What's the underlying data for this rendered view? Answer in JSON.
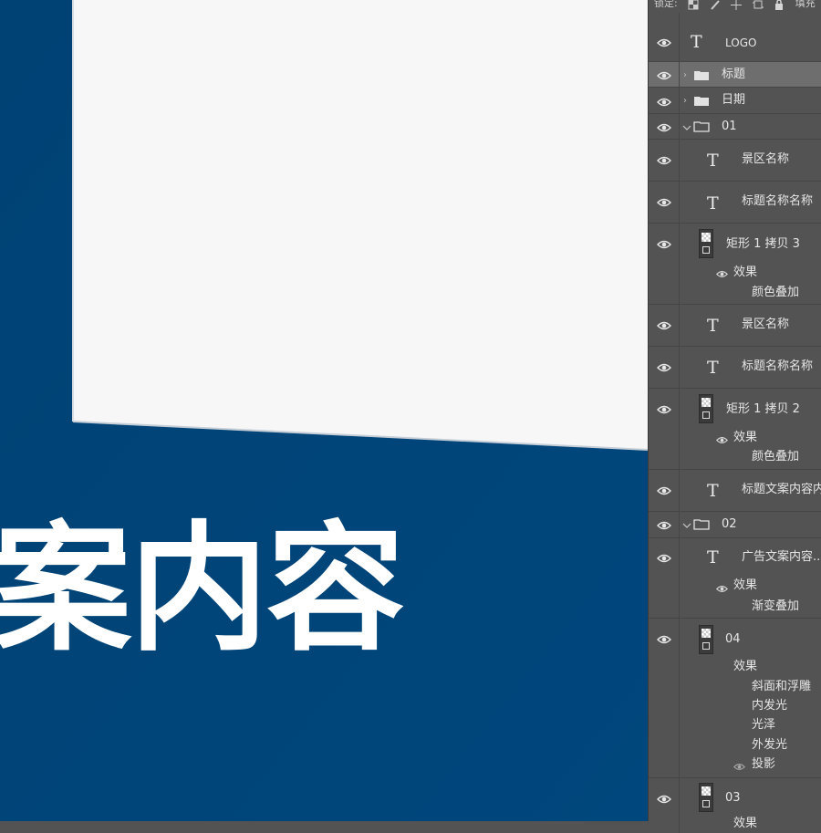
{
  "canvas": {
    "headline_text": "案内容",
    "colors": {
      "background": "#004477",
      "white_panel": "#f7f7f7",
      "text": "#ffffff"
    }
  },
  "lock_toolbar": {
    "label": "锁定:",
    "icons": [
      "lock-transparent-pixels-icon",
      "lock-image-pixels-icon",
      "lock-position-icon",
      "lock-artboard-icon",
      "lock-all-icon"
    ],
    "fill_label": "填充"
  },
  "layers": {
    "logo": {
      "name": "LOGO"
    },
    "title_group": {
      "name": "标题"
    },
    "date_group": {
      "name": "日期"
    },
    "group_01": {
      "name": "01"
    },
    "scenic_name_1": {
      "name": "景区名称"
    },
    "title_name_1": {
      "name": "标题名称名称"
    },
    "rect_copy_3": {
      "name": "矩形 1 拷贝 3",
      "effects_label": "效果",
      "effect": "颜色叠加"
    },
    "scenic_name_2": {
      "name": "景区名称"
    },
    "title_name_2": {
      "name": "标题名称名称"
    },
    "rect_copy_2": {
      "name": "矩形 1 拷贝 2",
      "effects_label": "效果",
      "effect": "颜色叠加"
    },
    "title_copy": {
      "name": "标题文案内容内"
    },
    "group_02": {
      "name": "02"
    },
    "ad_copy": {
      "name": "广告文案内容..",
      "effects_label": "效果",
      "effect": "渐变叠加"
    },
    "layer_04": {
      "name": "04",
      "effects_label": "效果",
      "effects": [
        "斜面和浮雕",
        "内发光",
        "光泽",
        "外发光",
        "投影"
      ]
    },
    "layer_03": {
      "name": "03",
      "effects_label": "效果"
    }
  },
  "panel_colors": {
    "background": "#535353",
    "selected_row": "#6e6e6e",
    "divider": "#464646"
  }
}
